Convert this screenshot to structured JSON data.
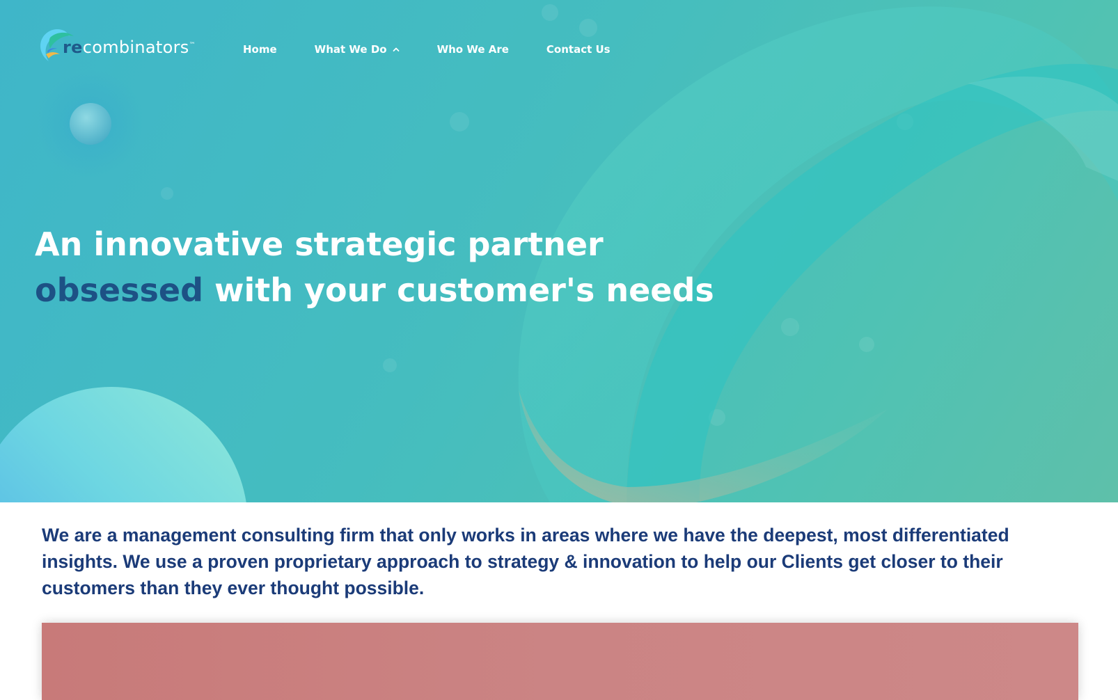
{
  "brand": {
    "logo_prefix": "re",
    "logo_suffix": "combinators",
    "trademark": "™",
    "logo_icon": "swirl-logo-icon"
  },
  "nav": {
    "items": [
      {
        "label": "Home"
      },
      {
        "label": "What We Do",
        "icon": "chevron-up-icon"
      },
      {
        "label": "Who We Are"
      },
      {
        "label": "Contact Us"
      }
    ]
  },
  "hero": {
    "headline_line1": "An innovative strategic partner",
    "headline_accent": "obsessed",
    "headline_line2_rest": " with your customer's needs"
  },
  "intro": {
    "text": "We are a management consulting firm that only works in areas where we have the deepest, most differentiated insights. We use a proven proprietary approach to strategy & innovation to help our Clients get closer to their customers than they ever thought possible."
  },
  "colors": {
    "hero_teal": "#45bdbf",
    "accent_navy": "#1d5185",
    "intro_text": "#1b3b78",
    "media_panel": "#cb8484"
  }
}
